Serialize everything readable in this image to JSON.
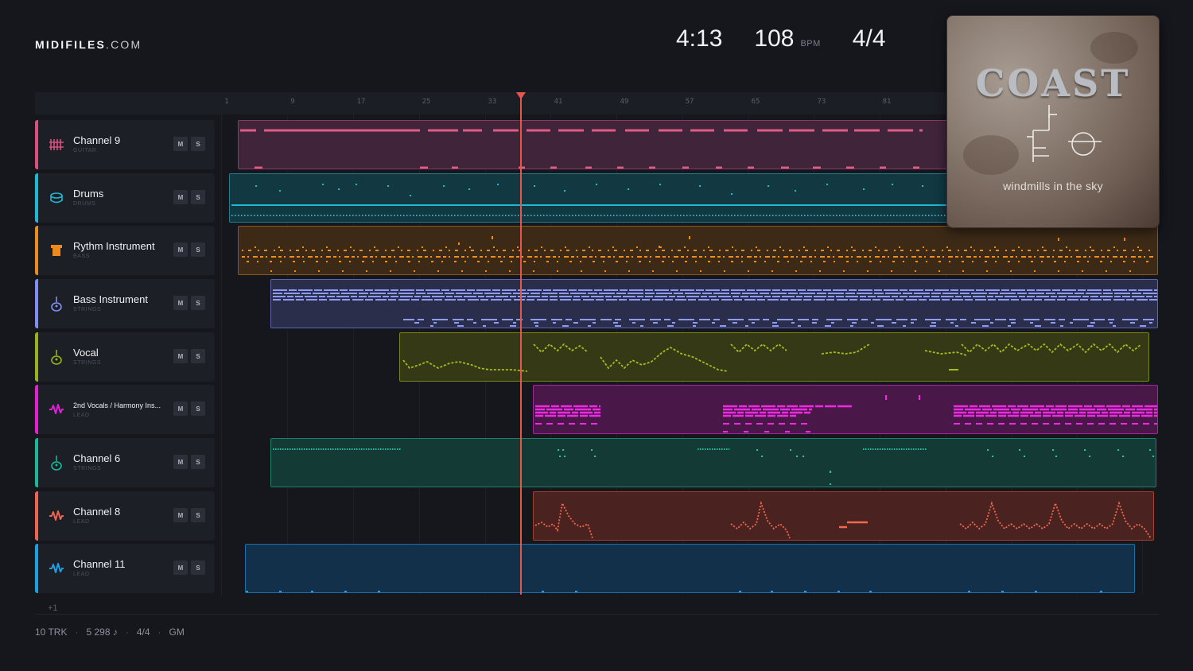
{
  "brand": {
    "name": "MIDIFILES",
    "domain": ".COM"
  },
  "transport": {
    "time": "4:13",
    "bpm": "108",
    "bpm_unit": "BPM",
    "signature": "4/4"
  },
  "ruler": {
    "ticks": [
      "1",
      "9",
      "17",
      "25",
      "33",
      "41",
      "49",
      "57",
      "65",
      "73",
      "81"
    ]
  },
  "tracks": [
    {
      "name": "Channel 9",
      "category": "GUITAR",
      "color": "#d9507f",
      "icon": "guitar-grid-icon",
      "mute": "M",
      "solo": "S"
    },
    {
      "name": "Drums",
      "category": "DRUMS",
      "color": "#1fb8d3",
      "icon": "drum-icon",
      "mute": "M",
      "solo": "S"
    },
    {
      "name": "Rythm Instrument",
      "category": "BASS",
      "color": "#ee8a1c",
      "icon": "bass-block-icon",
      "mute": "M",
      "solo": "S"
    },
    {
      "name": "Bass Instrument",
      "category": "STRINGS",
      "color": "#7e8ff2",
      "icon": "strings-icon",
      "mute": "M",
      "solo": "S"
    },
    {
      "name": "Vocal",
      "category": "STRINGS",
      "color": "#98b11c",
      "icon": "strings-icon",
      "mute": "M",
      "solo": "S"
    },
    {
      "name": "2nd Vocals / Harmony Ins...",
      "category": "LEAD",
      "color": "#e51fd8",
      "icon": "waveform-icon",
      "mute": "M",
      "solo": "S"
    },
    {
      "name": "Channel 6",
      "category": "STRINGS",
      "color": "#1fb59a",
      "icon": "strings-icon",
      "mute": "M",
      "solo": "S"
    },
    {
      "name": "Channel 8",
      "category": "LEAD",
      "color": "#f0644f",
      "icon": "waveform-icon",
      "mute": "M",
      "solo": "S"
    },
    {
      "name": "Channel 11",
      "category": "LEAD",
      "color": "#1d9fe6",
      "icon": "waveform-icon",
      "mute": "M",
      "solo": "S"
    }
  ],
  "more_tracks": "+1",
  "footer": {
    "tracks": "10 TRK",
    "notes": "5 298 ♪",
    "signature": "4/4",
    "standard": "GM"
  },
  "album": {
    "band": "COAST",
    "title": "windmills in the sky"
  }
}
